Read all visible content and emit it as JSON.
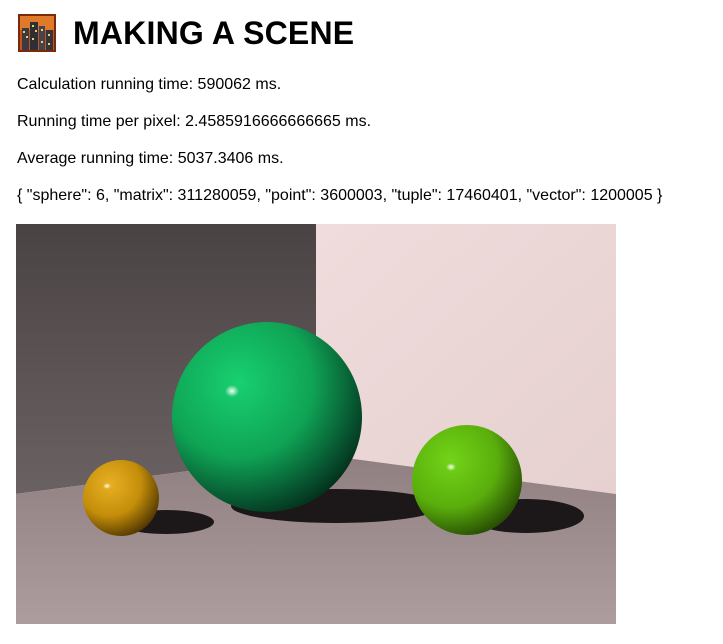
{
  "page": {
    "title": "MAKING A SCENE",
    "logo_icon": "pixel-city-icon"
  },
  "stats": {
    "calculation_time": "Calculation running time: 590062 ms.",
    "time_per_pixel": "Running time per pixel: 2.4585916666666665 ms.",
    "average_time": "Average running time: 5037.3406 ms.",
    "object_counts": "{ \"sphere\": 6, \"matrix\": 311280059, \"point\": 3600003, \"tuple\": 17460401, \"vector\": 1200005 }"
  },
  "render": {
    "spheres": [
      {
        "name": "small-yellow-sphere",
        "color": "#c8930a"
      },
      {
        "name": "large-green-sphere",
        "color": "#10c060"
      },
      {
        "name": "medium-lime-sphere",
        "color": "#62c010"
      }
    ],
    "colors": {
      "left_wall": "#4a4344",
      "right_wall": "#ead5d5",
      "floor": "#a89697"
    }
  }
}
